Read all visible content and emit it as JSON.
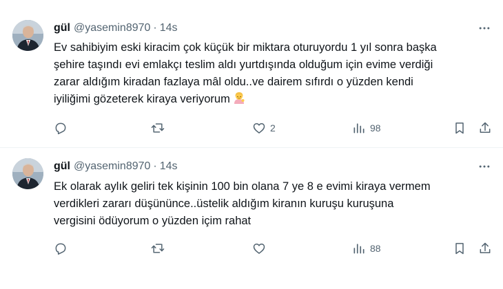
{
  "tweets": [
    {
      "display_name": "gül",
      "handle": "@yasemin8970",
      "separator": "·",
      "time": "14s",
      "text_lines": [
        "Ev sahibiyim eski kiracim çok küçük bir miktara oturuyordu 1 yıl sonra başka",
        "şehire taşındı evi emlakçı teslim aldı yurtdışında olduğum için evime verdiği",
        "zarar aldığım kiradan fazlaya mâl oldu..ve dairem sıfırdı o yüzden kendi",
        "iyiliğimi  gözeterek kiraya veriyorum"
      ],
      "emoji": "person-tipping-hand-emoji",
      "reply_count": "",
      "retweet_count": "",
      "like_count": "2",
      "view_count": "98"
    },
    {
      "display_name": "gül",
      "handle": "@yasemin8970",
      "separator": "·",
      "time": "14s",
      "text_lines": [
        "Ek olarak aylık geliri tek kişinin 100 bin olana 7 ye 8 e evimi kiraya vermem",
        "verdikleri zararı  düşününce..üstelik aldığım kiranın kuruşu kuruşuna",
        "vergisini ödüyorum o yüzden içim rahat"
      ],
      "reply_count": "",
      "retweet_count": "",
      "like_count": "",
      "view_count": "88"
    }
  ],
  "colors": {
    "text": "#0f1419",
    "secondary": "#536471",
    "divider": "#eff3f4"
  },
  "icons": [
    "more-icon",
    "reply-icon",
    "retweet-icon",
    "like-icon",
    "views-icon",
    "bookmark-icon",
    "share-icon"
  ]
}
